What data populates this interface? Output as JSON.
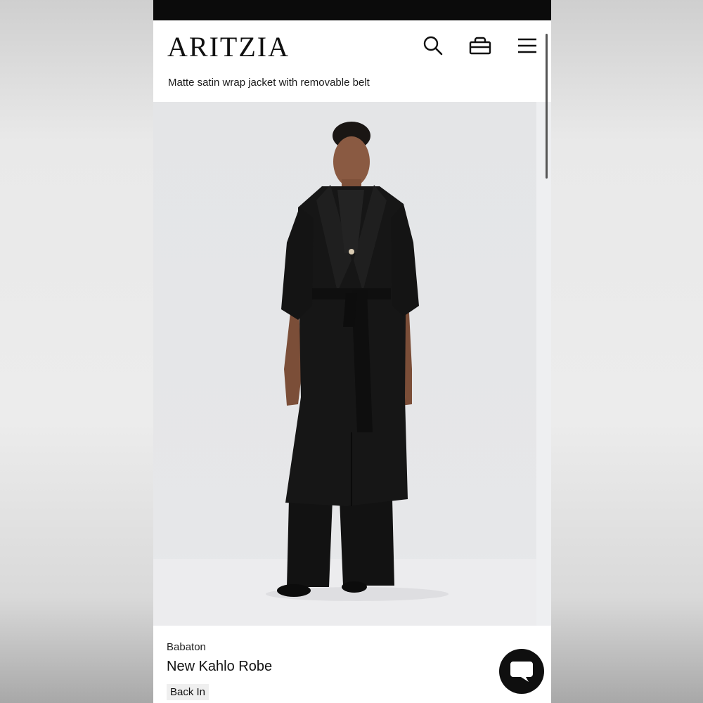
{
  "header": {
    "logo": "ARITZIA",
    "subtitle": "Matte satin wrap jacket with removable belt",
    "icons": [
      "search-icon",
      "shopping-bag-icon",
      "menu-icon"
    ]
  },
  "product": {
    "brand": "Babaton",
    "name": "New Kahlo Robe",
    "badge": "Back In"
  },
  "chat": {
    "icon": "chat-icon"
  },
  "colors": {
    "status_bar": "#0b0b0b",
    "background": "#ffffff",
    "image_backdrop": "#e5e6e8",
    "garment": "#141414",
    "badge_bg": "#efefef",
    "chat_button": "#0f0f0f"
  }
}
